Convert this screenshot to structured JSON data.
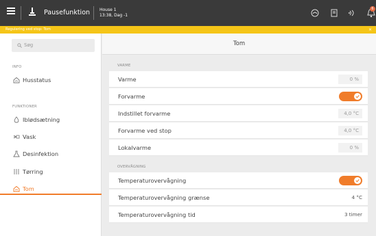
{
  "topbar": {
    "app_title": "Pausefunktion",
    "house_name": "House 1",
    "house_time": "13:38, Dag -1",
    "notification_count": "6"
  },
  "banner": {
    "text": "Regulering ved stop: Tom",
    "close": "×"
  },
  "sidebar": {
    "search_placeholder": "Søg",
    "sections": [
      {
        "label": "INFO"
      },
      {
        "label": "FUNKTIONER"
      }
    ],
    "items": [
      {
        "label": "Husstatus",
        "icon": "house-icon"
      },
      {
        "label": "Iblødsætning",
        "icon": "drop-icon"
      },
      {
        "label": "Vask",
        "icon": "spray-icon"
      },
      {
        "label": "Desinfektion",
        "icon": "flask-icon"
      },
      {
        "label": "Tørring",
        "icon": "dry-icon"
      },
      {
        "label": "Tom",
        "icon": "house-empty-icon",
        "active": true
      }
    ]
  },
  "main": {
    "title": "Tom",
    "groups": [
      {
        "label": "VARME",
        "rows": [
          {
            "label": "Varme",
            "value": "0 %"
          },
          {
            "label": "Forvarme",
            "toggle": true
          },
          {
            "label": "Indstillet forvarme",
            "value": "4,0 °C"
          },
          {
            "label": "Forvarme ved stop",
            "value": "4,0 °C"
          },
          {
            "label": "Lokalvarme",
            "value": "0 %"
          }
        ]
      },
      {
        "label": "OVERVÅGNING",
        "rows": [
          {
            "label": "Temperaturovervågning",
            "toggle": true
          },
          {
            "label": "Temperaturovervågning grænse",
            "value": "4 °C"
          },
          {
            "label": "Temperaturovervågning tid",
            "value": "3 timer"
          }
        ]
      }
    ]
  },
  "colors": {
    "accent": "#f07c2a",
    "topbar": "#3a3a3a",
    "banner": "#f5c518"
  }
}
